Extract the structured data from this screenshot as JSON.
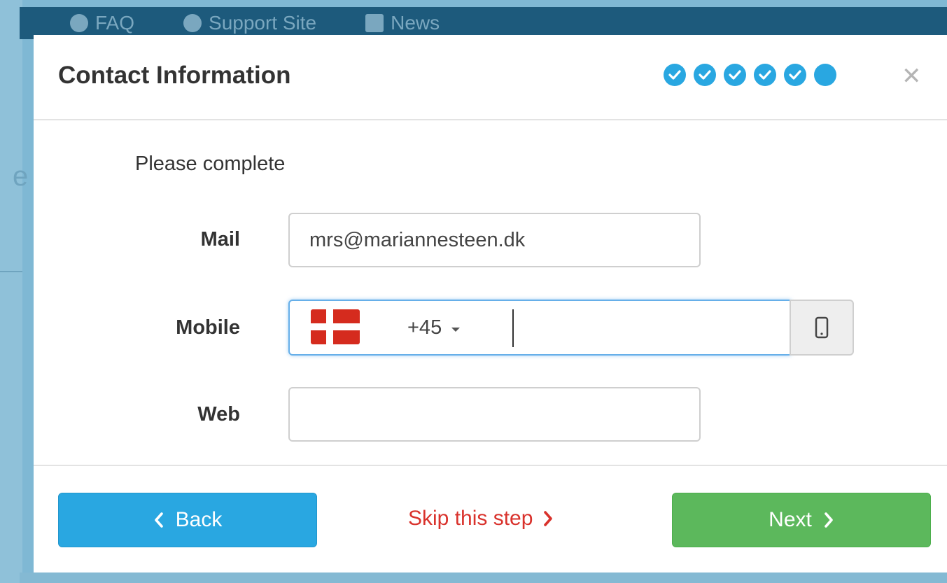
{
  "background": {
    "nav": [
      {
        "label": "FAQ",
        "icon": "question-circle-icon"
      },
      {
        "label": "Support Site",
        "icon": "arrow-circle-icon"
      },
      {
        "label": "News",
        "icon": "megaphone-icon"
      }
    ]
  },
  "modal": {
    "title": "Contact Information",
    "steps": {
      "total": 6,
      "completed": 5,
      "current": 6
    },
    "close_icon": "close-icon",
    "intro": "Please complete",
    "fields": {
      "mail": {
        "label": "Mail",
        "value": "mrs@mariannesteen.dk",
        "placeholder": ""
      },
      "mobile": {
        "label": "Mobile",
        "country_flag": "denmark-flag-icon",
        "dial_code": "+45",
        "value": "",
        "addon_icon": "mobile-phone-icon"
      },
      "web": {
        "label": "Web",
        "value": "",
        "placeholder": ""
      }
    },
    "footer": {
      "back_label": "Back",
      "skip_label": "Skip this step",
      "next_label": "Next"
    }
  },
  "colors": {
    "primary": "#29a7e1",
    "success": "#5cb85c",
    "danger": "#d9322c",
    "focus_border": "#66afe9"
  }
}
